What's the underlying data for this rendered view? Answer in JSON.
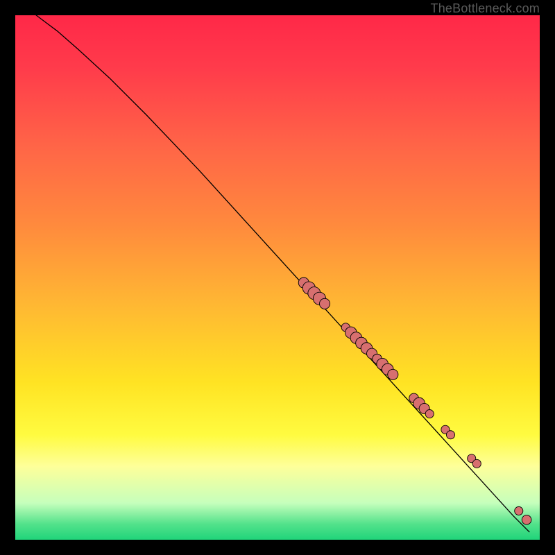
{
  "attribution": "TheBottleneck.com",
  "colors": {
    "gradient_top": "#ff2848",
    "gradient_mid1": "#ff8a3d",
    "gradient_mid2": "#ffe323",
    "gradient_bottom": "#20d47a",
    "curve": "#000000",
    "marker_fill": "#d76f6f",
    "marker_stroke": "#000000"
  },
  "chart_data": {
    "type": "line",
    "title": "",
    "xlabel": "",
    "ylabel": "",
    "xlim": [
      0,
      100
    ],
    "ylim": [
      0,
      100
    ],
    "grid": false,
    "curve": [
      {
        "x": 4,
        "y": 100
      },
      {
        "x": 6,
        "y": 98.5
      },
      {
        "x": 8,
        "y": 97
      },
      {
        "x": 12,
        "y": 93.5
      },
      {
        "x": 18,
        "y": 88
      },
      {
        "x": 25,
        "y": 81
      },
      {
        "x": 35,
        "y": 70.5
      },
      {
        "x": 45,
        "y": 59.5
      },
      {
        "x": 55,
        "y": 48.5
      },
      {
        "x": 65,
        "y": 37.5
      },
      {
        "x": 75,
        "y": 26.5
      },
      {
        "x": 85,
        "y": 15.5
      },
      {
        "x": 95,
        "y": 4.5
      },
      {
        "x": 98,
        "y": 1.5
      }
    ],
    "markers": [
      {
        "x": 55,
        "y": 49,
        "r": 1.0
      },
      {
        "x": 56,
        "y": 48,
        "r": 1.2
      },
      {
        "x": 57,
        "y": 47,
        "r": 1.2
      },
      {
        "x": 58,
        "y": 46,
        "r": 1.2
      },
      {
        "x": 59,
        "y": 45,
        "r": 1.0
      },
      {
        "x": 63,
        "y": 40.5,
        "r": 0.8
      },
      {
        "x": 64,
        "y": 39.5,
        "r": 1.1
      },
      {
        "x": 65,
        "y": 38.5,
        "r": 1.1
      },
      {
        "x": 66,
        "y": 37.5,
        "r": 1.1
      },
      {
        "x": 67,
        "y": 36.5,
        "r": 1.1
      },
      {
        "x": 68,
        "y": 35.5,
        "r": 1.0
      },
      {
        "x": 69,
        "y": 34.5,
        "r": 0.9
      },
      {
        "x": 70,
        "y": 33.5,
        "r": 1.1
      },
      {
        "x": 71,
        "y": 32.5,
        "r": 1.1
      },
      {
        "x": 72,
        "y": 31.5,
        "r": 1.0
      },
      {
        "x": 76,
        "y": 27,
        "r": 0.9
      },
      {
        "x": 77,
        "y": 26,
        "r": 1.1
      },
      {
        "x": 78,
        "y": 25,
        "r": 1.0
      },
      {
        "x": 79,
        "y": 24,
        "r": 0.8
      },
      {
        "x": 82,
        "y": 21,
        "r": 0.8
      },
      {
        "x": 83,
        "y": 20,
        "r": 0.8
      },
      {
        "x": 87,
        "y": 15.5,
        "r": 0.8
      },
      {
        "x": 88,
        "y": 14.5,
        "r": 0.8
      },
      {
        "x": 96,
        "y": 5.5,
        "r": 0.8
      },
      {
        "x": 97.5,
        "y": 3.8,
        "r": 0.9
      }
    ]
  }
}
